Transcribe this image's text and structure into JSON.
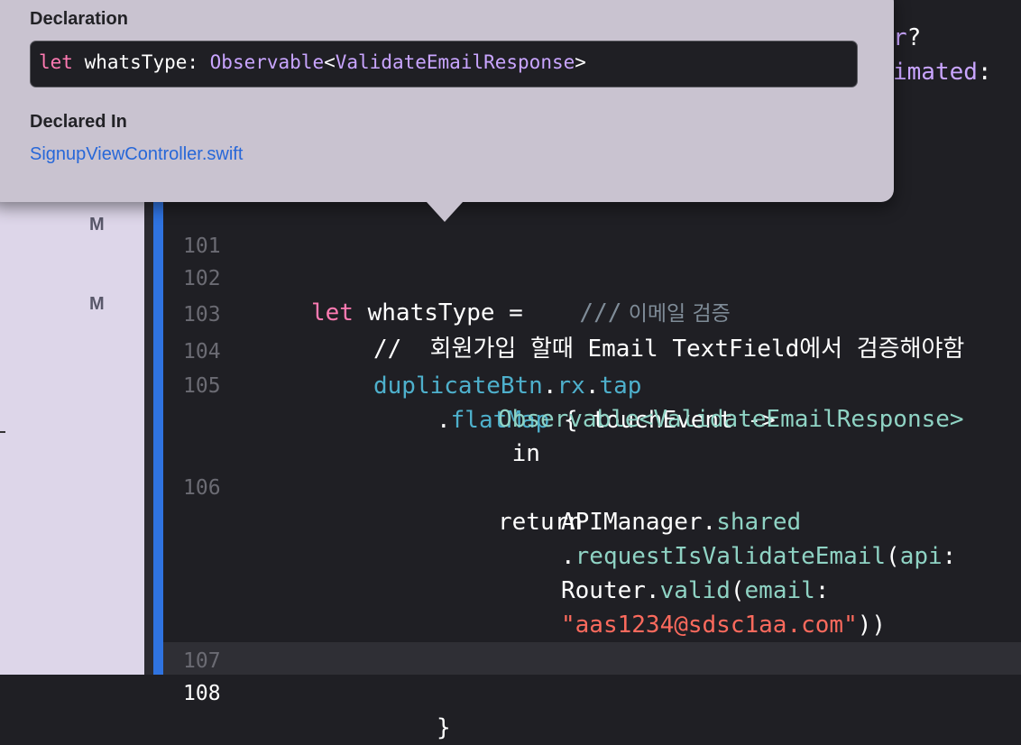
{
  "navigator": {
    "badges": [
      "M",
      "M"
    ]
  },
  "popover": {
    "declaration_heading": "Declaration",
    "declaration": {
      "keyword": "let",
      "name": " whatsType: ",
      "type_name": "Observable",
      "generic_open": "<",
      "generic_type": "ValidateEmailResponse",
      "generic_close": ">"
    },
    "declared_in_heading": "Declared In",
    "declared_in_file": "SignupViewController.swift"
  },
  "background_fragments": {
    "line_a_tail": "r",
    "line_a_punct": "?",
    "line_b_tail": "imated",
    "line_b_punct": ":"
  },
  "editor": {
    "current_line": "108",
    "lines": [
      {
        "num": "101"
      },
      {
        "num": "102",
        "kw": "let",
        "text": " whatsType = ",
        "comment_marker": "   ///",
        "comment": " 이메일 검증"
      },
      {
        "num": "103",
        "comment": "//  회원가입 할때 Email TextField에서 검증해야함"
      },
      {
        "num": "104",
        "obj": "duplicateBtn",
        "dot1": ".",
        "rx": "rx",
        "dot2": ".",
        "tap": "tap"
      },
      {
        "num": "105",
        "dot": ".",
        "method": "flatMap",
        "rest": " { touchEvent ->"
      },
      {
        "num": "",
        "type": "Observable",
        "generic": "<ValidateEmailResponse>"
      },
      {
        "num": "",
        "kw": " in"
      },
      {
        "num": "106",
        "kw": "return"
      },
      {
        "num": "",
        "cls": "APIManager",
        "dot": ".",
        "prop": "shared"
      },
      {
        "num": "",
        "dot": ".",
        "method": "requestIsValidateEmail",
        "paren": "(",
        "label": "api",
        "colon": ":"
      },
      {
        "num": "",
        "cls": "Router",
        "dot": ".",
        "method": "valid",
        "paren": "(",
        "label": "email",
        "colon": ":"
      },
      {
        "num": "",
        "str": "\"aas1234@sdsc1aa.com\"",
        "close": "))"
      },
      {
        "num": "107"
      },
      {
        "num": "108",
        "close": "}"
      }
    ]
  }
}
